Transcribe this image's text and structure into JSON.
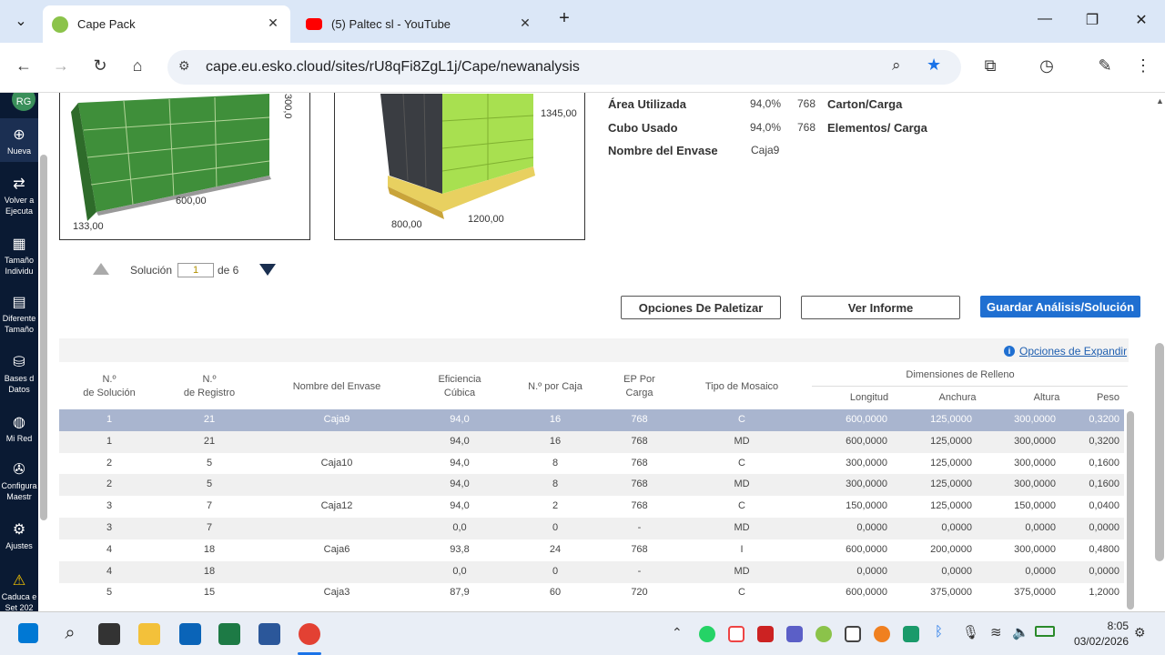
{
  "browser": {
    "tabs": [
      {
        "title": "Cape Pack",
        "active": true,
        "icon": "cape-pack-icon"
      },
      {
        "title": "(5) Paltec sl - YouTube",
        "active": false,
        "icon": "youtube-icon"
      }
    ],
    "url": "cape.eu.esko.cloud/sites/rU8qFi8ZgL1j/Cape/newanalysis"
  },
  "sidebar": {
    "avatar": "RG",
    "items": [
      {
        "label1": "Nueva",
        "label2": "",
        "icon": "plus-circle-icon"
      },
      {
        "label1": "Volver a",
        "label2": "Ejecuta",
        "icon": "return-icon"
      },
      {
        "label1": "Tamaño",
        "label2": "Individu",
        "icon": "boxes-icon"
      },
      {
        "label1": "Diferente",
        "label2": "Tamaño",
        "icon": "stack-icon"
      },
      {
        "label1": "Bases d",
        "label2": "Datos",
        "icon": "database-icon"
      },
      {
        "label1": "Mi Red",
        "label2": "",
        "icon": "globe-icon"
      },
      {
        "label1": "Configura",
        "label2": "Maestr",
        "icon": "wrench-icon"
      },
      {
        "label1": "Ajustes",
        "label2": "",
        "icon": "gear-icon"
      },
      {
        "label1": "Caduca e",
        "label2": "Set 202",
        "icon": "warning-icon"
      }
    ]
  },
  "images": {
    "left": {
      "dim_top": "300,0",
      "dim_mid": "600,00",
      "dim_left": "133,00"
    },
    "right": {
      "dim_top": "1345,00",
      "dim_left": "800,00",
      "dim_right": "1200,00"
    }
  },
  "summary": {
    "rows": [
      {
        "label": "Área Utilizada",
        "pct": "94,0%",
        "num": "768",
        "label2": "Carton/Carga"
      },
      {
        "label": "Cubo Usado",
        "pct": "94,0%",
        "num": "768",
        "label2": "Elementos/ Carga"
      },
      {
        "label": "Nombre del Envase",
        "pct": "Caja9",
        "num": "",
        "label2": ""
      }
    ]
  },
  "solution": {
    "label": "Solución",
    "value": "1",
    "of": "de 6"
  },
  "buttons": {
    "palletize": "Opciones De Paletizar",
    "report": "Ver Informe",
    "save": "Guardar Análisis/Solución"
  },
  "expand_link": "Opciones de Expandir",
  "table": {
    "headers": {
      "sol": [
        "N.º",
        "de Solución"
      ],
      "reg": [
        "N.º",
        "de Registro"
      ],
      "name": "Nombre del Envase",
      "eff": [
        "Eficiencia",
        "Cúbica"
      ],
      "per_box": "N.º por Caja",
      "ep": [
        "EP Por",
        "Carga"
      ],
      "mosaic": "Tipo de Mosaico",
      "fill_group": "Dimensiones de Relleno",
      "len": "Longitud",
      "wid": "Anchura",
      "hei": "Altura",
      "wt": "Peso"
    },
    "rows": [
      {
        "sol": "1",
        "reg": "21",
        "name": "Caja9",
        "eff": "94,0",
        "per": "16",
        "ep": "768",
        "mos": "C",
        "len": "600,0000",
        "wid": "125,0000",
        "hei": "300,0000",
        "wt": "0,3200"
      },
      {
        "sol": "1",
        "reg": "21",
        "name": "",
        "eff": "94,0",
        "per": "16",
        "ep": "768",
        "mos": "MD",
        "len": "600,0000",
        "wid": "125,0000",
        "hei": "300,0000",
        "wt": "0,3200"
      },
      {
        "sol": "2",
        "reg": "5",
        "name": "Caja10",
        "eff": "94,0",
        "per": "8",
        "ep": "768",
        "mos": "C",
        "len": "300,0000",
        "wid": "125,0000",
        "hei": "300,0000",
        "wt": "0,1600"
      },
      {
        "sol": "2",
        "reg": "5",
        "name": "",
        "eff": "94,0",
        "per": "8",
        "ep": "768",
        "mos": "MD",
        "len": "300,0000",
        "wid": "125,0000",
        "hei": "300,0000",
        "wt": "0,1600"
      },
      {
        "sol": "3",
        "reg": "7",
        "name": "Caja12",
        "eff": "94,0",
        "per": "2",
        "ep": "768",
        "mos": "C",
        "len": "150,0000",
        "wid": "125,0000",
        "hei": "150,0000",
        "wt": "0,0400"
      },
      {
        "sol": "3",
        "reg": "7",
        "name": "",
        "eff": "0,0",
        "per": "0",
        "ep": "-",
        "mos": "MD",
        "len": "0,0000",
        "wid": "0,0000",
        "hei": "0,0000",
        "wt": "0,0000"
      },
      {
        "sol": "4",
        "reg": "18",
        "name": "Caja6",
        "eff": "93,8",
        "per": "24",
        "ep": "768",
        "mos": "I",
        "len": "600,0000",
        "wid": "200,0000",
        "hei": "300,0000",
        "wt": "0,4800"
      },
      {
        "sol": "4",
        "reg": "18",
        "name": "",
        "eff": "0,0",
        "per": "0",
        "ep": "-",
        "mos": "MD",
        "len": "0,0000",
        "wid": "0,0000",
        "hei": "0,0000",
        "wt": "0,0000"
      },
      {
        "sol": "5",
        "reg": "15",
        "name": "Caja3",
        "eff": "87,9",
        "per": "60",
        "ep": "720",
        "mos": "C",
        "len": "600,0000",
        "wid": "375,0000",
        "hei": "375,0000",
        "wt": "1,2000"
      }
    ]
  },
  "clock": {
    "time": "8:05",
    "date": "03/02/2026"
  },
  "colors": {
    "primary": "#1f6fd1",
    "sidebar": "#0a1a33",
    "selected_row": "#a9b5cf",
    "pallet_green": "#a8e050"
  }
}
